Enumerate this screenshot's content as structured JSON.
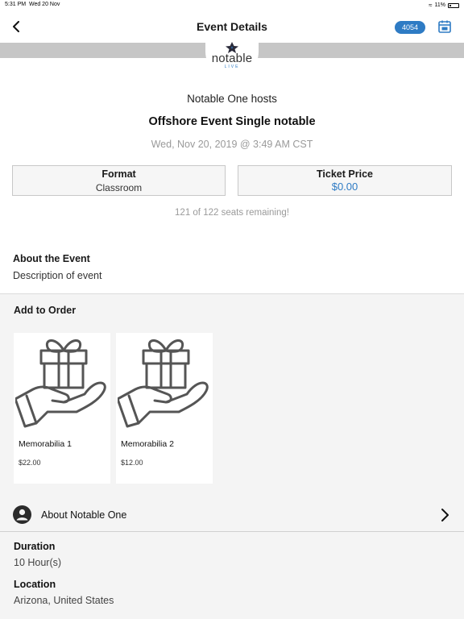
{
  "status_bar": {
    "time": "5:31 PM",
    "date": "Wed 20 Nov",
    "battery": "11%"
  },
  "nav": {
    "title": "Event Details",
    "ticket_count": "4054",
    "back_icon": "chevron-left-icon",
    "calendar_icon": "calendar-icon"
  },
  "logo": {
    "word": "notable",
    "sub": "LIVE"
  },
  "event": {
    "host_line": "Notable One hosts",
    "title": "Offshore Event Single notable",
    "datetime": "Wed, Nov 20, 2019 @ 3:49 AM CST",
    "format_label": "Format",
    "format_value": "Classroom",
    "price_label": "Ticket Price",
    "price_value": "$0.00",
    "seats": "121 of 122 seats remaining!"
  },
  "about": {
    "title": "About the Event",
    "description": "Description of event"
  },
  "order": {
    "title": "Add to Order",
    "items": [
      {
        "name": "Memorabilia 1",
        "price": "$22.00",
        "icon": "gift-in-hand-icon"
      },
      {
        "name": "Memorabilia 2",
        "price": "$12.00",
        "icon": "gift-in-hand-icon"
      }
    ]
  },
  "host": {
    "label": "About Notable One",
    "icon": "user-avatar-icon"
  },
  "details": {
    "duration_label": "Duration",
    "duration_value": "10 Hour(s)",
    "location_label": "Location",
    "location_value": "Arizona, United States"
  },
  "colors": {
    "accent": "#2e7bc4",
    "banner": "#c6c6c6",
    "section_bg": "#f4f4f4"
  }
}
